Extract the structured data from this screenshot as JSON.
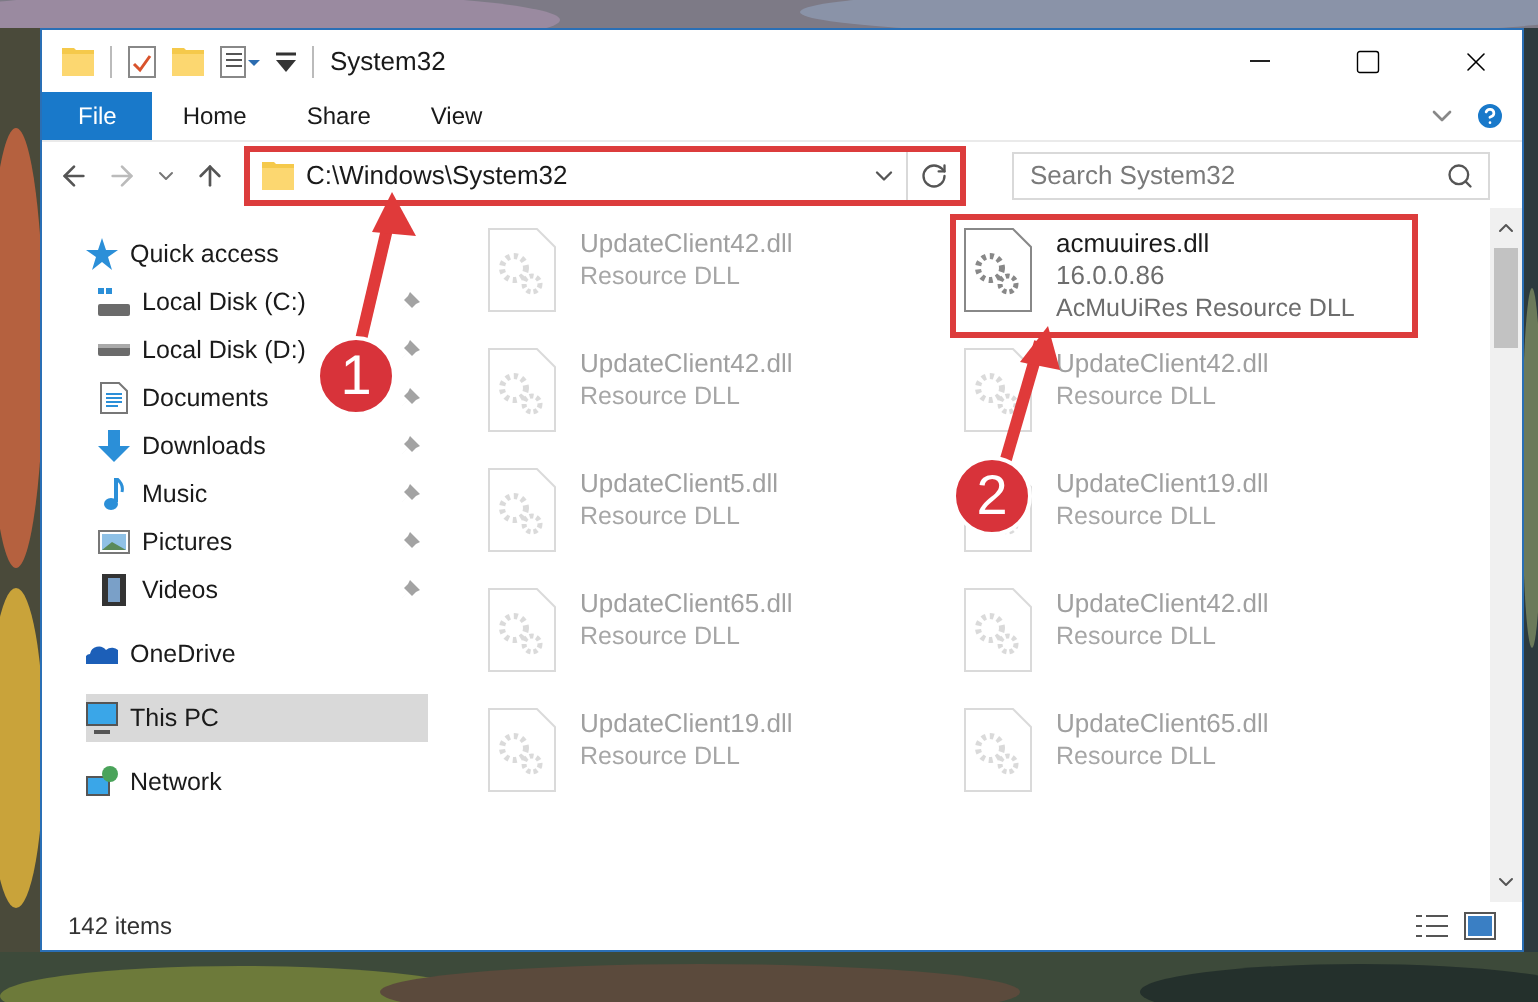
{
  "window": {
    "title": "System32"
  },
  "ribbon_tabs": [
    {
      "label": "File",
      "kind": "file",
      "selected": false
    },
    {
      "label": "Home",
      "kind": "tab",
      "selected": false
    },
    {
      "label": "Share",
      "kind": "tab",
      "selected": false
    },
    {
      "label": "View",
      "kind": "tab",
      "selected": false
    }
  ],
  "address_bar": {
    "path": "C:\\Windows\\System32",
    "highlighted": true
  },
  "search": {
    "placeholder": "Search System32"
  },
  "sidebar": {
    "items": [
      {
        "label": "Quick access",
        "selected": false,
        "children": [
          {
            "label": "Local Disk (C:)",
            "selected": false,
            "pinned": true
          },
          {
            "label": "Local Disk (D:)",
            "selected": false,
            "pinned": true
          },
          {
            "label": "Documents",
            "selected": false,
            "pinned": true
          },
          {
            "label": "Downloads",
            "selected": false,
            "pinned": true
          },
          {
            "label": "Music",
            "selected": false,
            "pinned": true
          },
          {
            "label": "Pictures",
            "selected": false,
            "pinned": true
          },
          {
            "label": "Videos",
            "selected": false,
            "pinned": true
          }
        ]
      },
      {
        "label": "OneDrive",
        "selected": false
      },
      {
        "label": "This PC",
        "selected": true
      },
      {
        "label": "Network",
        "selected": false
      }
    ]
  },
  "files": [
    {
      "name": "UpdateClient42.dll",
      "type": "Resource DLL",
      "dimmed": true,
      "highlighted": false
    },
    {
      "name": "acmuuires.dll",
      "version": "16.0.0.86",
      "type": "AcMuUiRes Resource DLL",
      "dimmed": false,
      "highlighted": true
    },
    {
      "name": "UpdateClient42.dll",
      "type": "Resource DLL",
      "dimmed": true,
      "highlighted": false
    },
    {
      "name": "UpdateClient42.dll",
      "type": "Resource DLL",
      "dimmed": true,
      "highlighted": false
    },
    {
      "name": "UpdateClient5.dll",
      "type": "Resource DLL",
      "dimmed": true,
      "highlighted": false
    },
    {
      "name": "UpdateClient19.dll",
      "type": "Resource DLL",
      "dimmed": true,
      "highlighted": false
    },
    {
      "name": "UpdateClient65.dll",
      "type": "Resource DLL",
      "dimmed": true,
      "highlighted": false
    },
    {
      "name": "UpdateClient42.dll",
      "type": "Resource DLL",
      "dimmed": true,
      "highlighted": false
    },
    {
      "name": "UpdateClient19.dll",
      "type": "Resource DLL",
      "dimmed": true,
      "highlighted": false
    },
    {
      "name": "UpdateClient65.dll",
      "type": "Resource DLL",
      "dimmed": true,
      "highlighted": false
    }
  ],
  "status_bar": {
    "item_count": "142 items"
  },
  "annotations": [
    {
      "number": "1"
    },
    {
      "number": "2"
    }
  ]
}
